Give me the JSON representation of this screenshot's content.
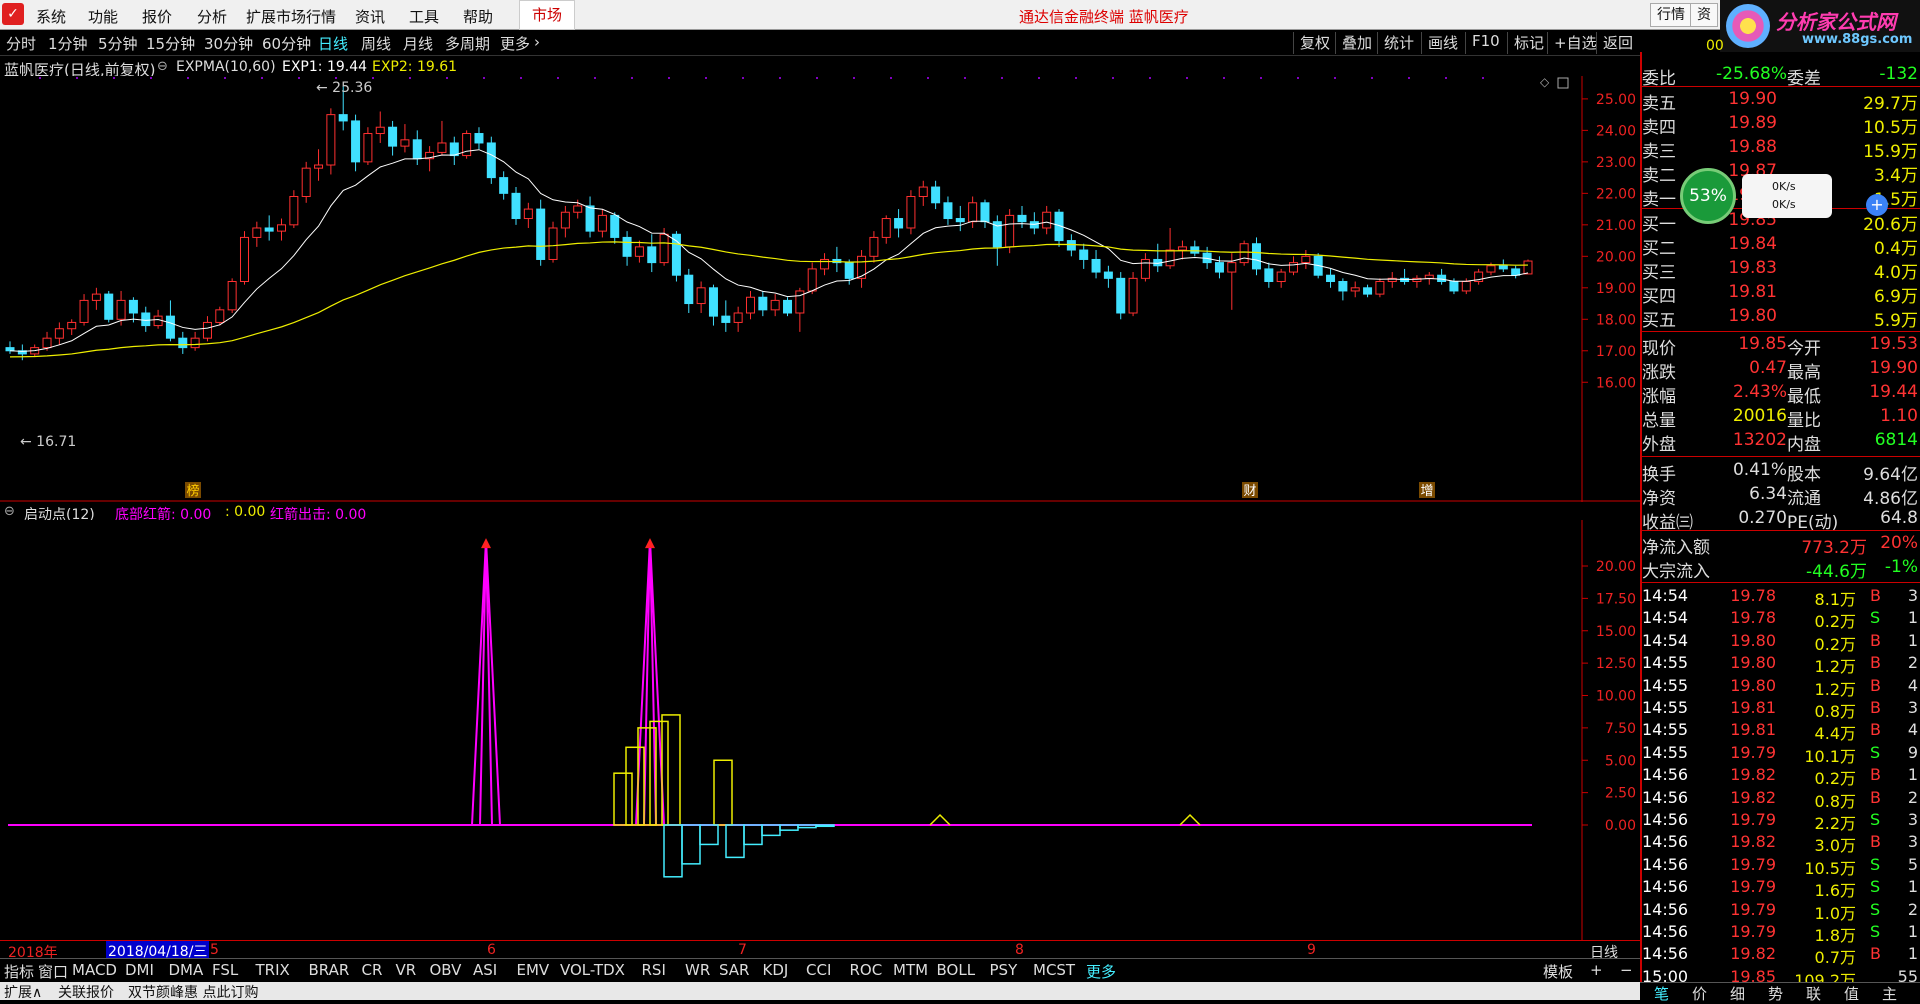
{
  "menu": {
    "items": [
      "系统",
      "功能",
      "报价",
      "分析",
      "扩展市场行情",
      "资讯",
      "工具",
      "帮助"
    ],
    "market": "市场",
    "title": "通达信金融终端  蓝帆医疗",
    "right_buttons": [
      "行情",
      "资"
    ]
  },
  "brand": {
    "title": "分析家公式网",
    "url": "www.88gs.com"
  },
  "periods": [
    "分时",
    "1分钟",
    "5分钟",
    "15分钟",
    "30分钟",
    "60分钟",
    "日线",
    "周线",
    "月线",
    "多周期",
    "更多"
  ],
  "active_period": "日线",
  "tools": [
    "复权",
    "叠加",
    "统计",
    "画线",
    "F10",
    "标记",
    "+自选",
    "返回"
  ],
  "main_chart": {
    "stock": "蓝帆医疗(日线,前复权)",
    "indicator": "EXPMA(10,60)",
    "exp1": "EXP1: 19.44",
    "exp2": "EXP2: 19.61",
    "high_label": "25.36",
    "low_label": "16.71",
    "y_ticks": [
      "25.00",
      "24.00",
      "23.00",
      "22.00",
      "21.00",
      "20.00",
      "19.00",
      "18.00",
      "17.00",
      "16.00"
    ],
    "markers": [
      "榜",
      "财",
      "增"
    ]
  },
  "sub_chart": {
    "name": "启动点(12)",
    "line1": "底部红箭: 0.00",
    "line2": ": 0.00",
    "line3": "红箭出击: 0.00",
    "y_ticks": [
      "20.00",
      "17.50",
      "15.00",
      "12.50",
      "10.00",
      "7.50",
      "5.00",
      "2.50",
      "0.00"
    ]
  },
  "date_axis": {
    "year": "2018年",
    "cursor": "2018/04/18/三",
    "months": [
      "5",
      "6",
      "7",
      "8",
      "9"
    ],
    "period": "日线"
  },
  "bottom_tabs": [
    "指标",
    "窗口",
    "MACD",
    "DMI",
    "DMA",
    "FSL",
    "TRIX",
    "BRAR",
    "CR",
    "VR",
    "OBV",
    "ASI",
    "EMV",
    "VOL-TDX",
    "RSI",
    "WR",
    "SAR",
    "KDJ",
    "CCI",
    "ROC",
    "MTM",
    "BOLL",
    "PSY",
    "MCST",
    "更多"
  ],
  "bottom_right": [
    "模板",
    "+",
    "−"
  ],
  "status": [
    "扩展∧",
    "关联报价",
    "双节颜峰惠 点此订购"
  ],
  "right_tabs": [
    "笔",
    "价",
    "细",
    "势",
    "联",
    "值",
    "主"
  ],
  "quote": {
    "top_code": "00",
    "weibi": {
      "label": "委比",
      "value": "-25.68%",
      "label2": "委差",
      "value2": "-132"
    },
    "asks": [
      {
        "label": "卖五",
        "price": "19.90",
        "vol": "29.7万"
      },
      {
        "label": "卖四",
        "price": "19.89",
        "vol": "10.5万"
      },
      {
        "label": "卖三",
        "price": "19.88",
        "vol": "15.9万"
      },
      {
        "label": "卖二",
        "price": "19.87",
        "vol": "3.4万"
      },
      {
        "label": "卖一",
        "price": "19.85",
        "vol": "1.5万"
      }
    ],
    "bids": [
      {
        "label": "买一",
        "price": "19.85",
        "vol": "20.6万"
      },
      {
        "label": "买二",
        "price": "19.84",
        "vol": "0.4万"
      },
      {
        "label": "买三",
        "price": "19.83",
        "vol": "4.0万"
      },
      {
        "label": "买四",
        "price": "19.81",
        "vol": "6.9万"
      },
      {
        "label": "买五",
        "price": "19.80",
        "vol": "5.9万"
      }
    ],
    "stats": [
      {
        "l1": "现价",
        "v1": "19.85",
        "l2": "今开",
        "v2": "19.53"
      },
      {
        "l1": "涨跌",
        "v1": "0.47",
        "l2": "最高",
        "v2": "19.90"
      },
      {
        "l1": "涨幅",
        "v1": "2.43%",
        "l2": "最低",
        "v2": "19.44"
      },
      {
        "l1": "总量",
        "v1": "20016",
        "l2": "量比",
        "v2": "1.10"
      },
      {
        "l1": "外盘",
        "v1": "13202",
        "l2": "内盘",
        "v2": "6814"
      }
    ],
    "stats2": [
      {
        "l1": "换手",
        "v1": "0.41%",
        "l2": "股本",
        "v2": "9.64亿"
      },
      {
        "l1": "净资",
        "v1": "6.34",
        "l2": "流通",
        "v2": "4.86亿"
      },
      {
        "l1": "收益㈢",
        "v1": "0.270",
        "l2": "PE(动)",
        "v2": "64.8"
      }
    ],
    "flow": [
      {
        "label": "净流入额",
        "value": "773.2万",
        "pct": "20%"
      },
      {
        "label": "大宗流入",
        "value": "-44.6万",
        "pct": "-1%"
      }
    ],
    "widget": {
      "pct": "53%",
      "up": "0K/s",
      "down": "0K/s"
    }
  },
  "ticks": [
    {
      "t": "14:54",
      "p": "19.78",
      "v": "8.1万",
      "s": "B",
      "n": "3"
    },
    {
      "t": "14:54",
      "p": "19.78",
      "v": "0.2万",
      "s": "S",
      "n": "1"
    },
    {
      "t": "14:54",
      "p": "19.80",
      "v": "0.2万",
      "s": "B",
      "n": "1"
    },
    {
      "t": "14:55",
      "p": "19.80",
      "v": "1.2万",
      "s": "B",
      "n": "2"
    },
    {
      "t": "14:55",
      "p": "19.80",
      "v": "1.2万",
      "s": "B",
      "n": "4"
    },
    {
      "t": "14:55",
      "p": "19.81",
      "v": "0.8万",
      "s": "B",
      "n": "3"
    },
    {
      "t": "14:55",
      "p": "19.81",
      "v": "4.4万",
      "s": "B",
      "n": "4"
    },
    {
      "t": "14:55",
      "p": "19.79",
      "v": "10.1万",
      "s": "S",
      "n": "9"
    },
    {
      "t": "14:56",
      "p": "19.82",
      "v": "0.2万",
      "s": "B",
      "n": "1"
    },
    {
      "t": "14:56",
      "p": "19.82",
      "v": "0.8万",
      "s": "B",
      "n": "2"
    },
    {
      "t": "14:56",
      "p": "19.79",
      "v": "2.2万",
      "s": "S",
      "n": "3"
    },
    {
      "t": "14:56",
      "p": "19.82",
      "v": "3.0万",
      "s": "B",
      "n": "3"
    },
    {
      "t": "14:56",
      "p": "19.79",
      "v": "10.5万",
      "s": "S",
      "n": "5"
    },
    {
      "t": "14:56",
      "p": "19.79",
      "v": "1.6万",
      "s": "S",
      "n": "1"
    },
    {
      "t": "14:56",
      "p": "19.79",
      "v": "1.0万",
      "s": "S",
      "n": "2"
    },
    {
      "t": "14:56",
      "p": "19.79",
      "v": "1.8万",
      "s": "S",
      "n": "1"
    },
    {
      "t": "14:56",
      "p": "19.82",
      "v": "0.7万",
      "s": "B",
      "n": "1"
    },
    {
      "t": "15:00",
      "p": "19.85",
      "v": "109.2万",
      "s": "",
      "n": "55"
    }
  ],
  "chart_data": {
    "type": "candlestick",
    "price_range": [
      15.5,
      25.6
    ],
    "candles": [
      [
        17.1,
        17.3,
        16.9,
        17.0
      ],
      [
        17.0,
        17.2,
        16.7,
        16.9
      ],
      [
        16.9,
        17.2,
        16.8,
        17.1
      ],
      [
        17.1,
        17.6,
        17.0,
        17.4
      ],
      [
        17.4,
        17.9,
        17.2,
        17.7
      ],
      [
        17.7,
        18.0,
        17.5,
        17.9
      ],
      [
        17.9,
        18.8,
        17.8,
        18.6
      ],
      [
        18.6,
        19.0,
        18.3,
        18.8
      ],
      [
        18.8,
        18.9,
        17.9,
        18.0
      ],
      [
        18.0,
        18.9,
        17.8,
        18.6
      ],
      [
        18.6,
        18.7,
        17.9,
        18.2
      ],
      [
        18.2,
        18.4,
        17.6,
        17.8
      ],
      [
        17.8,
        18.3,
        17.7,
        18.1
      ],
      [
        18.1,
        18.6,
        17.3,
        17.4
      ],
      [
        17.4,
        17.6,
        16.9,
        17.1
      ],
      [
        17.1,
        17.6,
        17.0,
        17.4
      ],
      [
        17.4,
        18.1,
        17.3,
        17.9
      ],
      [
        17.9,
        18.4,
        17.8,
        18.3
      ],
      [
        18.3,
        19.3,
        18.2,
        19.2
      ],
      [
        19.2,
        20.8,
        19.1,
        20.6
      ],
      [
        20.6,
        21.1,
        20.3,
        20.9
      ],
      [
        20.9,
        21.3,
        20.5,
        20.8
      ],
      [
        20.8,
        21.2,
        20.5,
        21.0
      ],
      [
        21.0,
        22.1,
        20.9,
        21.9
      ],
      [
        21.9,
        23.0,
        21.7,
        22.8
      ],
      [
        22.8,
        23.4,
        22.4,
        22.9
      ],
      [
        22.9,
        24.7,
        22.6,
        24.5
      ],
      [
        24.5,
        25.4,
        24.0,
        24.3
      ],
      [
        24.3,
        24.5,
        22.7,
        23.0
      ],
      [
        23.0,
        24.1,
        22.9,
        23.9
      ],
      [
        23.9,
        24.6,
        23.6,
        24.1
      ],
      [
        24.1,
        24.3,
        23.2,
        23.5
      ],
      [
        23.5,
        24.2,
        23.3,
        23.7
      ],
      [
        23.7,
        24.0,
        22.9,
        23.1
      ],
      [
        23.1,
        23.5,
        22.7,
        23.3
      ],
      [
        23.3,
        24.3,
        23.2,
        23.6
      ],
      [
        23.6,
        23.8,
        22.9,
        23.2
      ],
      [
        23.2,
        24.0,
        23.1,
        23.9
      ],
      [
        23.9,
        24.1,
        23.4,
        23.6
      ],
      [
        23.6,
        23.8,
        22.3,
        22.5
      ],
      [
        22.5,
        22.7,
        21.8,
        22.0
      ],
      [
        22.0,
        22.2,
        21.0,
        21.2
      ],
      [
        21.2,
        21.7,
        20.9,
        21.5
      ],
      [
        21.5,
        21.8,
        19.7,
        19.9
      ],
      [
        19.9,
        21.1,
        19.8,
        20.9
      ],
      [
        20.9,
        21.6,
        20.6,
        21.4
      ],
      [
        21.4,
        21.8,
        21.2,
        21.6
      ],
      [
        21.6,
        21.9,
        20.6,
        20.8
      ],
      [
        20.8,
        21.5,
        20.6,
        21.3
      ],
      [
        21.3,
        21.4,
        20.4,
        20.6
      ],
      [
        20.6,
        20.8,
        19.7,
        20.0
      ],
      [
        20.0,
        20.5,
        19.8,
        20.3
      ],
      [
        20.3,
        20.7,
        19.5,
        19.8
      ],
      [
        19.8,
        20.9,
        19.7,
        20.7
      ],
      [
        20.7,
        20.8,
        19.2,
        19.4
      ],
      [
        19.4,
        19.6,
        18.2,
        18.5
      ],
      [
        18.5,
        19.2,
        18.2,
        19.0
      ],
      [
        19.0,
        19.1,
        17.8,
        18.1
      ],
      [
        18.1,
        18.6,
        17.6,
        17.9
      ],
      [
        17.9,
        18.4,
        17.6,
        18.2
      ],
      [
        18.2,
        18.9,
        18.0,
        18.7
      ],
      [
        18.7,
        18.9,
        18.1,
        18.3
      ],
      [
        18.3,
        18.8,
        18.1,
        18.6
      ],
      [
        18.6,
        18.7,
        18.1,
        18.2
      ],
      [
        18.2,
        19.0,
        17.6,
        18.9
      ],
      [
        18.9,
        19.8,
        18.8,
        19.6
      ],
      [
        19.6,
        20.1,
        19.4,
        19.9
      ],
      [
        19.9,
        20.3,
        19.5,
        19.8
      ],
      [
        19.8,
        19.9,
        19.1,
        19.3
      ],
      [
        19.3,
        20.2,
        19.0,
        20.0
      ],
      [
        20.0,
        20.8,
        19.8,
        20.6
      ],
      [
        20.6,
        21.3,
        20.4,
        21.2
      ],
      [
        21.2,
        21.5,
        20.6,
        20.9
      ],
      [
        20.9,
        22.1,
        20.7,
        21.9
      ],
      [
        21.9,
        22.4,
        21.6,
        22.2
      ],
      [
        22.2,
        22.4,
        21.5,
        21.7
      ],
      [
        21.7,
        21.9,
        21.0,
        21.2
      ],
      [
        21.2,
        21.6,
        20.8,
        21.1
      ],
      [
        21.1,
        21.9,
        20.9,
        21.7
      ],
      [
        21.7,
        21.8,
        20.9,
        21.1
      ],
      [
        21.1,
        21.3,
        19.7,
        20.3
      ],
      [
        20.3,
        21.5,
        20.1,
        21.3
      ],
      [
        21.3,
        21.6,
        20.9,
        21.1
      ],
      [
        21.1,
        21.4,
        20.7,
        20.9
      ],
      [
        20.9,
        21.6,
        20.7,
        21.4
      ],
      [
        21.4,
        21.5,
        20.3,
        20.5
      ],
      [
        20.5,
        20.7,
        20.0,
        20.2
      ],
      [
        20.2,
        20.4,
        19.6,
        19.9
      ],
      [
        19.9,
        20.2,
        19.3,
        19.5
      ],
      [
        19.5,
        19.7,
        19.0,
        19.3
      ],
      [
        19.3,
        19.5,
        18.0,
        18.2
      ],
      [
        18.2,
        19.5,
        18.1,
        19.3
      ],
      [
        19.3,
        20.1,
        19.2,
        19.9
      ],
      [
        19.9,
        20.4,
        19.5,
        19.7
      ],
      [
        19.7,
        20.9,
        19.6,
        20.2
      ],
      [
        20.2,
        20.5,
        19.9,
        20.3
      ],
      [
        20.3,
        20.5,
        20.0,
        20.1
      ],
      [
        20.1,
        20.3,
        19.6,
        19.8
      ],
      [
        19.8,
        20.0,
        19.3,
        19.5
      ],
      [
        19.5,
        20.1,
        18.3,
        19.8
      ],
      [
        19.8,
        20.5,
        19.7,
        20.4
      ],
      [
        20.4,
        20.6,
        19.4,
        19.6
      ],
      [
        19.6,
        19.8,
        19.0,
        19.2
      ],
      [
        19.2,
        19.6,
        19.0,
        19.5
      ],
      [
        19.5,
        20.0,
        19.4,
        19.8
      ],
      [
        19.8,
        20.2,
        19.6,
        20.0
      ],
      [
        20.0,
        20.1,
        19.3,
        19.4
      ],
      [
        19.4,
        19.6,
        19.0,
        19.2
      ],
      [
        19.2,
        19.3,
        18.6,
        18.9
      ],
      [
        18.9,
        19.2,
        18.7,
        19.0
      ],
      [
        19.0,
        19.1,
        18.7,
        18.8
      ],
      [
        18.8,
        19.3,
        18.7,
        19.2
      ],
      [
        19.2,
        19.5,
        19.0,
        19.3
      ],
      [
        19.3,
        19.6,
        19.1,
        19.2
      ],
      [
        19.2,
        19.4,
        19.0,
        19.3
      ],
      [
        19.3,
        19.5,
        19.1,
        19.4
      ],
      [
        19.4,
        19.6,
        19.1,
        19.2
      ],
      [
        19.2,
        19.3,
        18.8,
        18.9
      ],
      [
        18.9,
        19.3,
        18.8,
        19.2
      ],
      [
        19.2,
        19.6,
        19.1,
        19.5
      ],
      [
        19.5,
        19.8,
        19.4,
        19.7
      ],
      [
        19.7,
        19.9,
        19.5,
        19.6
      ],
      [
        19.6,
        19.7,
        19.3,
        19.4
      ],
      [
        19.44,
        19.9,
        19.44,
        19.85
      ]
    ]
  }
}
